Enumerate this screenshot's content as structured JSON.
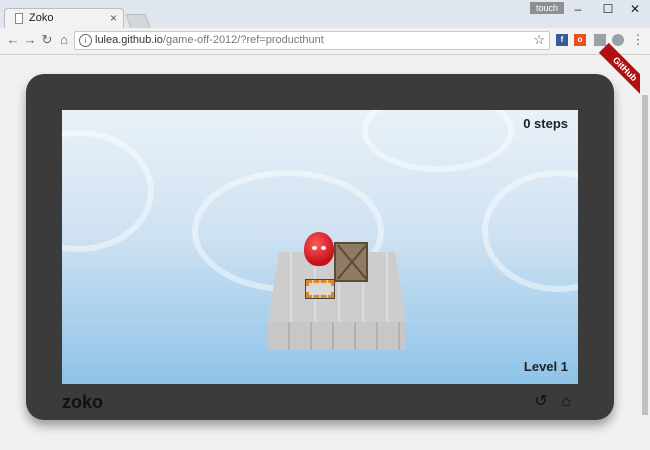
{
  "browser": {
    "tab_title": "Zoko",
    "touch_label": "touch",
    "url_host": "lulea.github.io",
    "url_path": "/game-off-2012/?ref=producthunt"
  },
  "game": {
    "steps_text": "0 steps",
    "level_text": "Level 1",
    "logo_text": "zoko",
    "ribbon_text": "GitHub"
  }
}
